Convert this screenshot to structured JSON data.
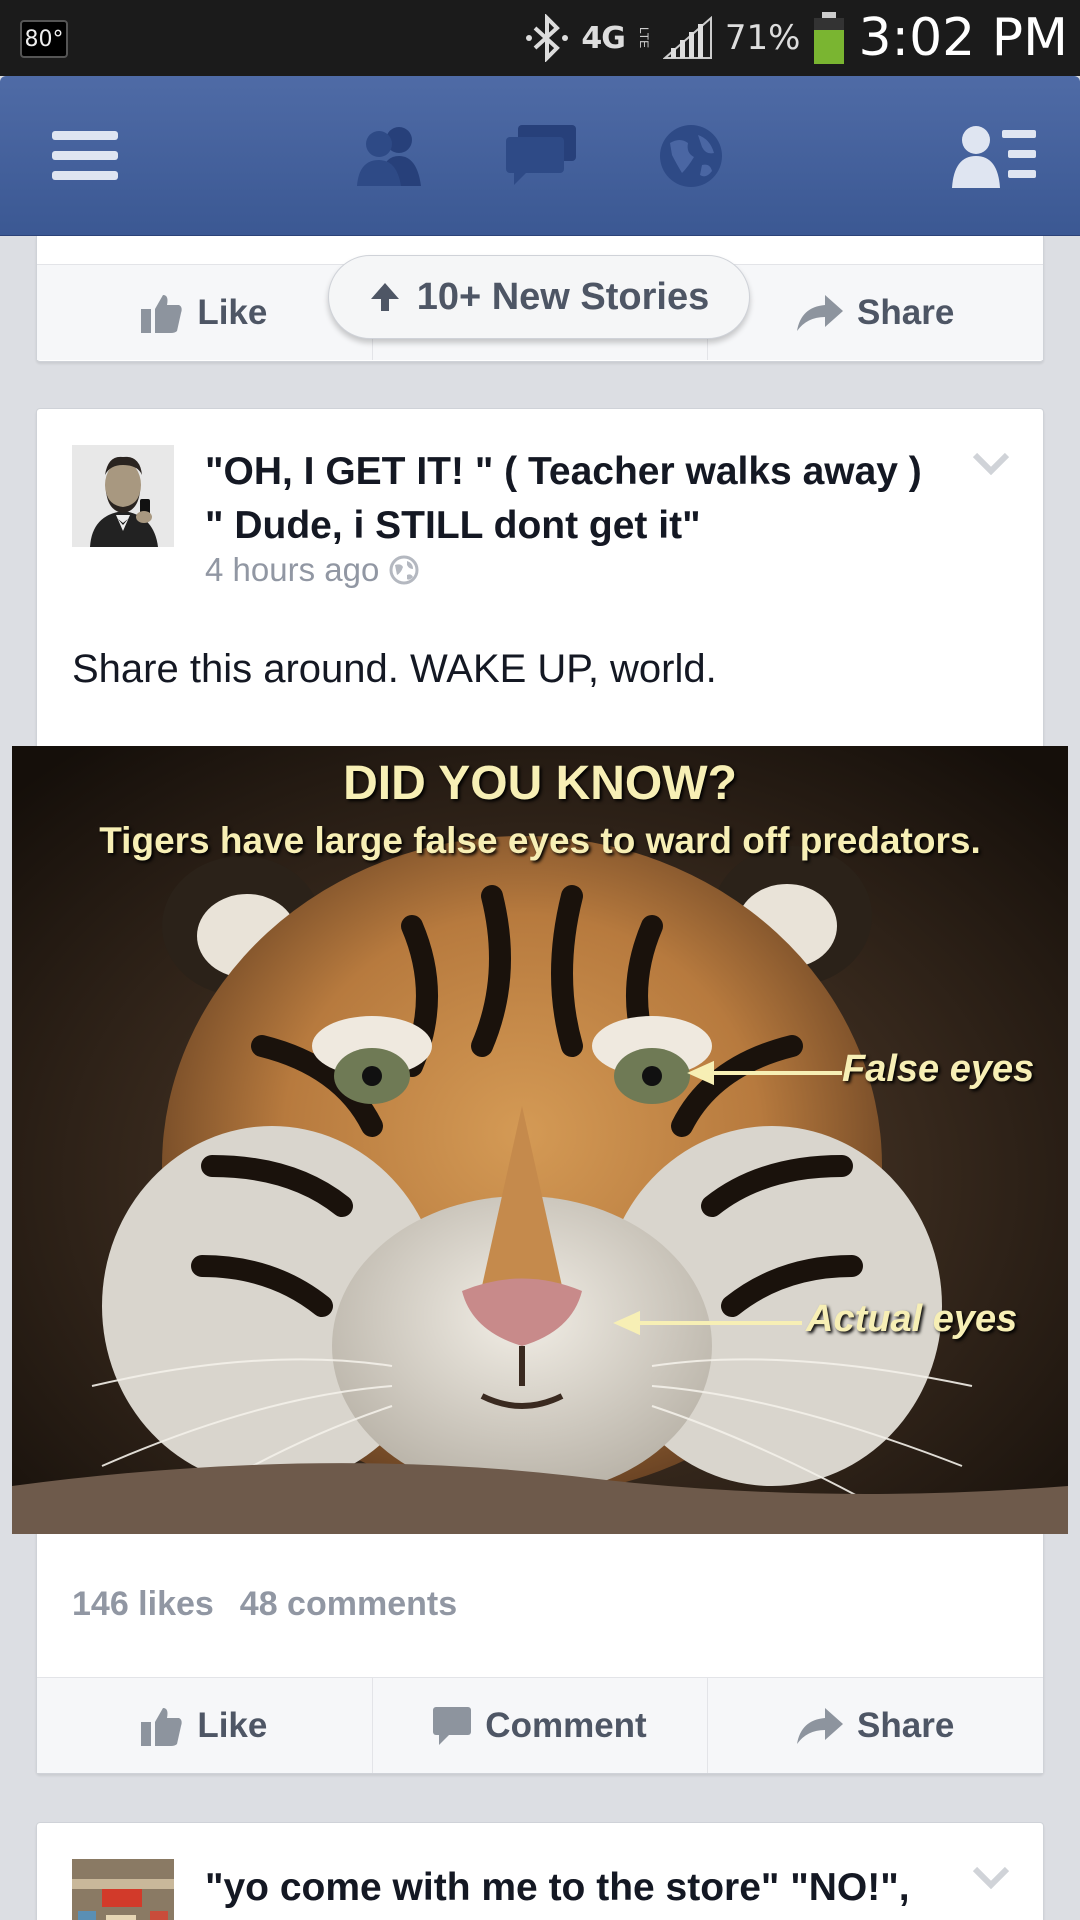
{
  "status_bar": {
    "temperature": "80°",
    "network": "4G",
    "network_sub": "LTE",
    "battery": "71%",
    "time": "3:02 PM"
  },
  "nav": {
    "items": [
      "menu-icon",
      "friend-requests-icon",
      "messages-icon",
      "notifications-globe-icon",
      "friends-list-icon"
    ]
  },
  "prev_card": {
    "like_label": "Like",
    "share_label": "Share"
  },
  "new_stories": {
    "label": "10+ New Stories"
  },
  "post": {
    "title_line1": "\"OH, I GET IT! \" ( Teacher walks away )",
    "title_line2": "\" Dude, i STILL dont get it\"",
    "time": "4 hours ago",
    "text": "Share this around. WAKE UP, world.",
    "image": {
      "heading": "DID YOU KNOW?",
      "subheading": "Tigers have large false eyes to ward off predators.",
      "label_false": "False eyes",
      "label_actual": "Actual eyes"
    },
    "likes": "146 likes",
    "comments": "48 comments",
    "actions": {
      "like": "Like",
      "comment": "Comment",
      "share": "Share"
    }
  },
  "next_post": {
    "title": "\"yo come with me to the store\" \"NO!\","
  },
  "colors": {
    "nav_blue": "#3b5893",
    "text_dark": "#141823",
    "text_gray": "#9197a3",
    "action_gray": "#4e5665"
  }
}
